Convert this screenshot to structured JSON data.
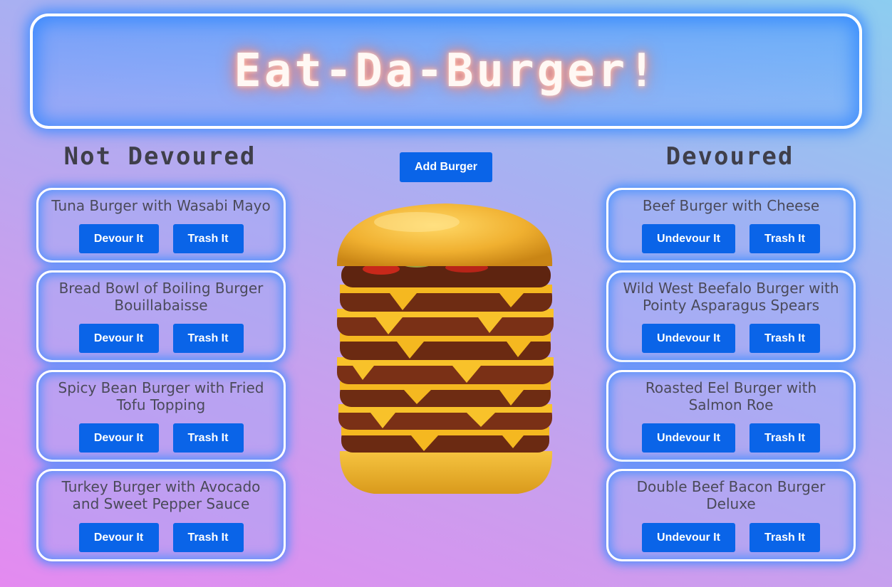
{
  "title": "Eat-Da-Burger!",
  "add_button": "Add Burger",
  "not_devoured": {
    "heading": "Not Devoured",
    "devour_label": "Devour It",
    "trash_label": "Trash It",
    "items": [
      {
        "name": "Tuna Burger with Wasabi Mayo"
      },
      {
        "name": "Bread Bowl of Boiling Burger Bouillabaisse"
      },
      {
        "name": "Spicy Bean Burger with Fried Tofu Topping"
      },
      {
        "name": "Turkey Burger with Avocado and Sweet Pepper Sauce"
      }
    ]
  },
  "devoured": {
    "heading": "Devoured",
    "undevour_label": "Undevour It",
    "trash_label": "Trash It",
    "items": [
      {
        "name": "Beef Burger with Cheese"
      },
      {
        "name": "Wild West Beefalo Burger with Pointy Asparagus Spears"
      },
      {
        "name": "Roasted Eel Burger with Salmon Roe"
      },
      {
        "name": "Double Beef Bacon Burger Deluxe"
      }
    ]
  },
  "colors": {
    "button": "#0a64e8",
    "neon_blue": "#3c8cff",
    "title_glow": "#ff6a50"
  },
  "icons": {
    "hero_image": "stacked-burger-image"
  }
}
